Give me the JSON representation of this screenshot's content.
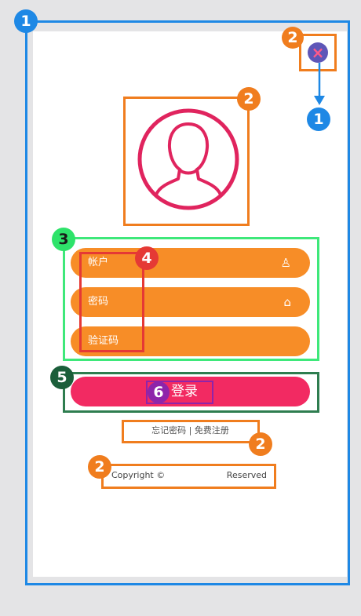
{
  "badges": {
    "container": "1",
    "close": "2",
    "close_target": "1",
    "avatar": "2",
    "inputs": "3",
    "labels": "4",
    "login": "5",
    "login_text": "6",
    "links": "2",
    "copyright": "2"
  },
  "close_button": {
    "symbol": "×"
  },
  "avatar": {
    "icon": "user-silhouette-icon",
    "color": "#e0245e"
  },
  "fields": [
    {
      "label": "帐户",
      "icon": "person-icon",
      "glyph": "♙"
    },
    {
      "label": "密码",
      "icon": "lock-icon",
      "glyph": "⌂"
    },
    {
      "label": "验证码"
    }
  ],
  "login": {
    "label": "登录"
  },
  "links": {
    "text": "忘记密码 | 免费注册"
  },
  "footer": {
    "copyright_left": "Copyright ©",
    "copyright_right": "Reserved"
  },
  "colors": {
    "frame": "#1e88e5",
    "annotation_orange": "#f07d1e",
    "annotation_green": "#3ee87a",
    "annotation_red": "#e53935",
    "annotation_darkgreen": "#2e7d4f",
    "annotation_purple": "#8e24aa",
    "input_fill": "#f78d27",
    "login_fill": "#f22a62"
  }
}
